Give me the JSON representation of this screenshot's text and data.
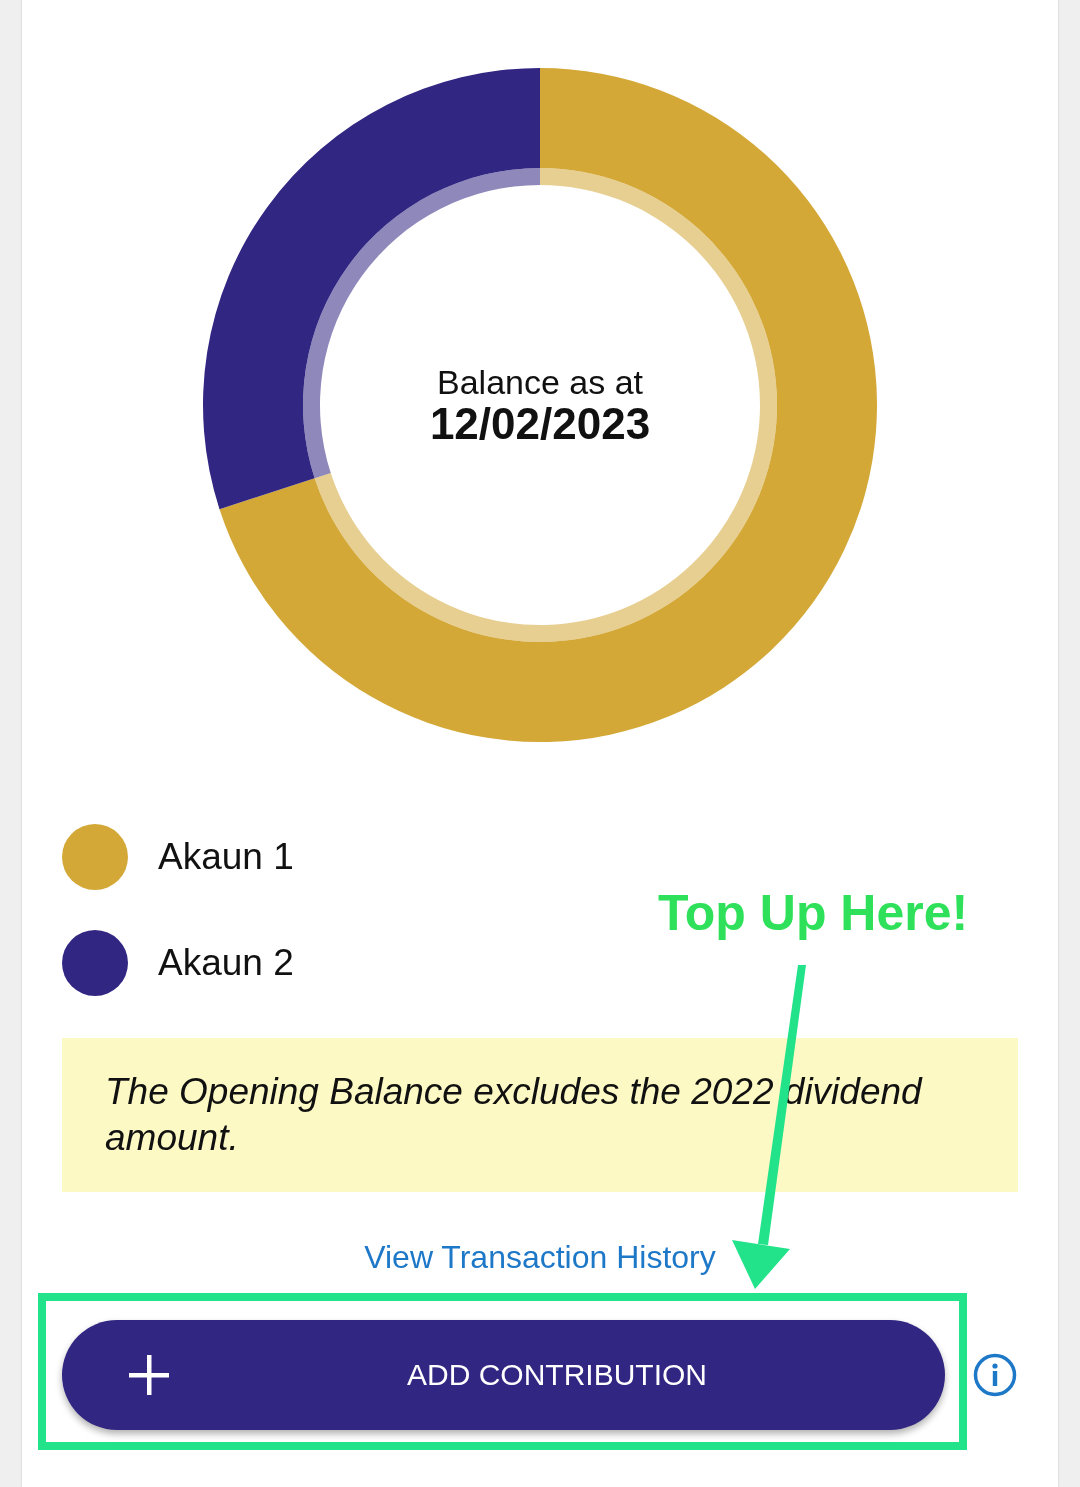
{
  "chart": {
    "center_label": "Balance as at",
    "center_date": "12/02/2023"
  },
  "legend": [
    {
      "label": "Akaun 1",
      "color": "#d4a837"
    },
    {
      "label": "Akaun 2",
      "color": "#312783"
    }
  ],
  "note": "The Opening Balance excludes the 2022 dividend amount.",
  "link": "View Transaction History",
  "button": {
    "label": "ADD CONTRIBUTION"
  },
  "annotation": {
    "text": "Top Up Here!"
  }
}
